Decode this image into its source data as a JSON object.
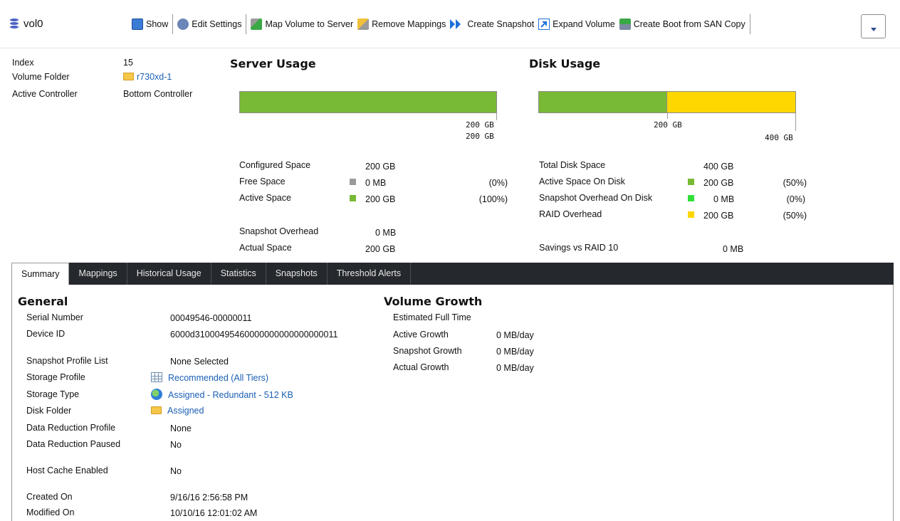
{
  "header": {
    "title": "vol0",
    "actions": [
      {
        "label": "Show",
        "icon": "show-icon",
        "color": "#3a7bd5"
      },
      {
        "label": "Edit Settings",
        "icon": "settings-icon",
        "color": "#4a6fa5"
      },
      {
        "label": "Map Volume to Server",
        "icon": "map-server-icon",
        "color": "#3aa845"
      },
      {
        "label": "Remove Mappings",
        "icon": "remove-mappings-icon",
        "color": "#d9a820"
      },
      {
        "label": "Create Snapshot",
        "icon": "snapshot-icon",
        "color": "#1e6fd8"
      },
      {
        "label": "Expand Volume",
        "icon": "expand-icon",
        "color": "#1e6fd8"
      },
      {
        "label": "Create Boot from SAN Copy",
        "icon": "boot-san-icon",
        "color": "#3aa845"
      }
    ],
    "more_icon": "chevron-down-icon"
  },
  "info": {
    "index_label": "Index",
    "index_value": "15",
    "folder_label": "Volume Folder",
    "folder_value": "r730xd-1",
    "controller_label": "Active Controller",
    "controller_value": "Bottom Controller"
  },
  "server_usage": {
    "title": "Server Usage",
    "fill_fraction": 1.0,
    "bar_color": "#78b935",
    "tick_label_1": "200 GB",
    "tick_label_2": "200 GB",
    "configured_label": "Configured Space",
    "configured_value": "200 GB",
    "free_label": "Free Space",
    "free_value": "0 MB",
    "free_pct": "(0%)",
    "free_color": "#9a9a9a",
    "active_label": "Active Space",
    "active_value": "200 GB",
    "active_pct": "(100%)",
    "active_color": "#78b935",
    "snapshot_overhead_label": "Snapshot Overhead",
    "snapshot_overhead_value": "0 MB",
    "actual_label": "Actual Space",
    "actual_value": "200 GB"
  },
  "disk_usage": {
    "title": "Disk Usage",
    "active_fraction": 0.5,
    "raid_fraction": 0.5,
    "tick_label_1": "200 GB",
    "tick_label_2": "400 GB",
    "total_label": "Total Disk Space",
    "total_value": "400 GB",
    "active_label": "Active Space On Disk",
    "active_value": "200 GB",
    "active_pct": "(50%)",
    "active_color": "#78b935",
    "snapshot_label": "Snapshot Overhead On Disk",
    "snapshot_value": "0 MB",
    "snapshot_pct": "(0%)",
    "snapshot_color": "#33e03a",
    "raid_label": "RAID Overhead",
    "raid_value": "200 GB",
    "raid_pct": "(50%)",
    "raid_color": "#ffd700",
    "savings_label": "Savings vs RAID 10",
    "savings_value": "0 MB"
  },
  "tabs": [
    {
      "label": "Summary",
      "active": true
    },
    {
      "label": "Mappings",
      "active": false
    },
    {
      "label": "Historical Usage",
      "active": false
    },
    {
      "label": "Statistics",
      "active": false
    },
    {
      "label": "Snapshots",
      "active": false
    },
    {
      "label": "Threshold Alerts",
      "active": false
    }
  ],
  "general": {
    "title": "General",
    "serial_label": "Serial Number",
    "serial_value": "00049546-00000011",
    "device_label": "Device ID",
    "device_value": "6000d31000495460000000000000000011",
    "snapshot_profile_label": "Snapshot Profile List",
    "snapshot_profile_value": "None Selected",
    "storage_profile_label": "Storage Profile",
    "storage_profile_value": "Recommended (All Tiers)",
    "storage_type_label": "Storage Type",
    "storage_type_value": "Assigned - Redundant - 512 KB",
    "disk_folder_label": "Disk Folder",
    "disk_folder_value": "Assigned",
    "dr_profile_label": "Data Reduction Profile",
    "dr_profile_value": "None",
    "dr_paused_label": "Data Reduction Paused",
    "dr_paused_value": "No",
    "host_cache_label": "Host Cache Enabled",
    "host_cache_value": "No",
    "created_label": "Created On",
    "created_value": "9/16/16 2:56:58 PM",
    "modified_label": "Modified On",
    "modified_value": "10/10/16 12:01:02 AM"
  },
  "volume_growth": {
    "title": "Volume Growth",
    "estimated_label": "Estimated Full Time",
    "active_label": "Active Growth",
    "active_value": "0 MB/day",
    "snapshot_label": "Snapshot Growth",
    "snapshot_value": "0 MB/day",
    "actual_label": "Actual Growth",
    "actual_value": "0 MB/day"
  }
}
